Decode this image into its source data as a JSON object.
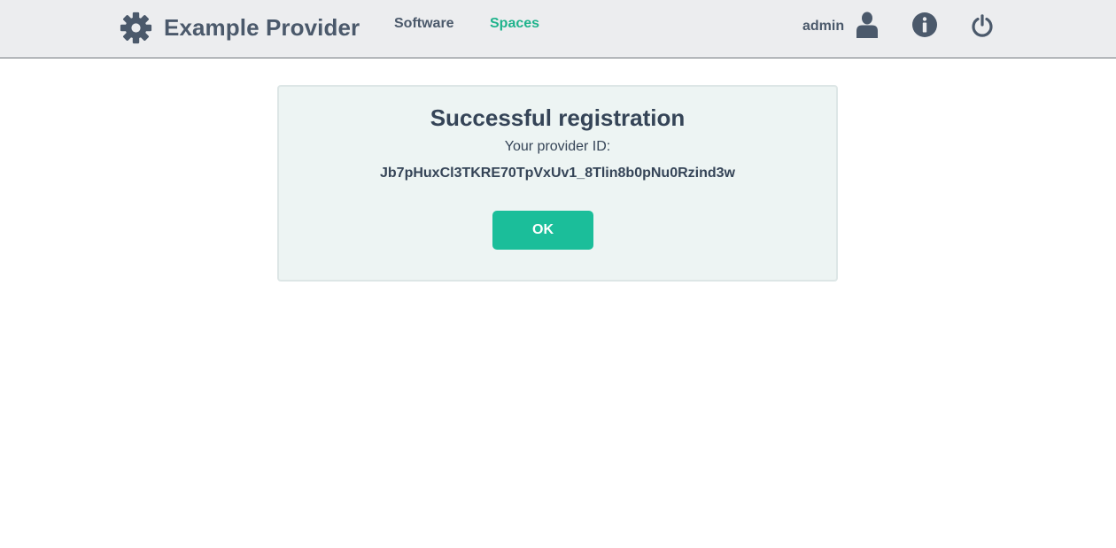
{
  "header": {
    "brand_icon": "gear-icon",
    "brand_title": "Example Provider",
    "nav": [
      {
        "label": "Software",
        "active": false
      },
      {
        "label": "Spaces",
        "active": true
      }
    ],
    "user": {
      "name": "admin",
      "icon": "user-icon"
    },
    "info_icon": "info-icon",
    "logout_icon": "power-icon"
  },
  "dialog": {
    "title": "Successful registration",
    "id_label": "Your provider ID:",
    "provider_id": "Jb7pHuxCl3TKRE70TpVxUv1_8Tlin8b0pNu0Rzind3w",
    "ok_label": "OK"
  },
  "colors": {
    "header_bg": "#ecedef",
    "text_dark": "#354457",
    "nav_text": "#4b596b",
    "accent": "#1fb38c",
    "button": "#1bbe9a",
    "panel_bg": "#edf4f3"
  }
}
